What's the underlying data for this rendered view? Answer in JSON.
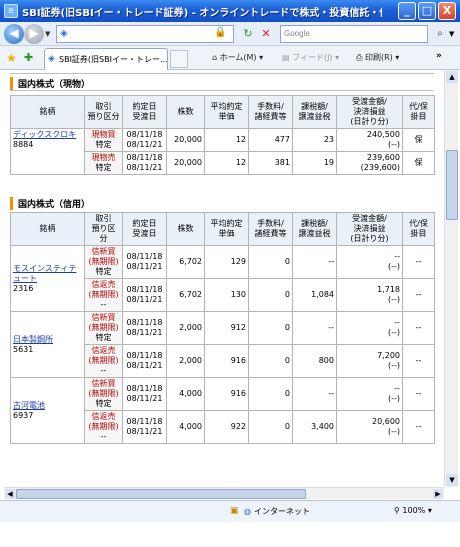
{
  "window": {
    "title": "SBI証券(旧SBIイー・トレード証券) - オンライントレードで株式・投資信託・債券を - W...",
    "min_label": "_",
    "max_label": "□",
    "close_label": "X"
  },
  "address": {
    "search_placeholder": "Google"
  },
  "command": {
    "tab_label": "SBI証券(旧SBIイー・トレー...",
    "home": "ホーム(M)",
    "feed": "フィード(J)",
    "print": "印刷(R)",
    "more": "»"
  },
  "cash": {
    "title": "国内株式（現物）",
    "headers": [
      "銘柄",
      "取引\n預り区分",
      "約定日\n受渡日",
      "株数",
      "平均約定\n単価",
      "手数料/\n諸経費等",
      "課税額/\n譲渡益税",
      "受渡金額/\n決済損益\n(日計り分)",
      "代/保\n掛目"
    ],
    "stock_name": "ディックスクロキ",
    "stock_code": "8884",
    "rows": [
      {
        "type1": "現物買",
        "type2": "特定",
        "d1": "08/11/18",
        "d2": "08/11/21",
        "qty": "20,000",
        "price": "12",
        "fee": "477",
        "tax": "23",
        "amt1": "240,500",
        "amt2": "(--)",
        "flag": "保"
      },
      {
        "type1": "現物売",
        "type2": "特定",
        "d1": "08/11/18",
        "d2": "08/11/21",
        "qty": "20,000",
        "price": "12",
        "fee": "381",
        "tax": "19",
        "amt1": "239,600",
        "amt2": "(239,600)",
        "flag": "保"
      }
    ]
  },
  "margin": {
    "title": "国内株式（信用）",
    "headers": [
      "銘柄",
      "取引\n預り区\n分",
      "約定日\n受渡日",
      "株数",
      "平均約定\n単価",
      "手数料/\n諸経費等",
      "課税額/\n譲渡益税",
      "受渡金額/\n決済損益\n(日計り分)",
      "代/保\n掛目"
    ],
    "groups": [
      {
        "name": "モスインスティテュート",
        "code": "2316",
        "rows": [
          {
            "t1": "信新買",
            "t2": "(無期限)",
            "t3": "特定",
            "d1": "08/11/18",
            "d2": "08/11/21",
            "qty": "6,702",
            "price": "129",
            "fee": "0",
            "tax": "--",
            "amt1": "--",
            "amt2": "(--)",
            "flag": "--"
          },
          {
            "t1": "信返売",
            "t2": "(無期限)",
            "t3": "--",
            "d1": "08/11/18",
            "d2": "08/11/21",
            "qty": "6,702",
            "price": "130",
            "fee": "0",
            "tax": "1,084",
            "amt1": "1,718",
            "amt2": "(--)",
            "flag": "--"
          }
        ]
      },
      {
        "name": "日本製鋼所",
        "code": "5631",
        "rows": [
          {
            "t1": "信新買",
            "t2": "(無期限)",
            "t3": "特定",
            "d1": "08/11/18",
            "d2": "08/11/21",
            "qty": "2,000",
            "price": "912",
            "fee": "0",
            "tax": "--",
            "amt1": "--",
            "amt2": "(--)",
            "flag": "--"
          },
          {
            "t1": "信返売",
            "t2": "(無期限)",
            "t3": "--",
            "d1": "08/11/18",
            "d2": "08/11/21",
            "qty": "2,000",
            "price": "916",
            "fee": "0",
            "tax": "800",
            "amt1": "7,200",
            "amt2": "(--)",
            "flag": "--"
          }
        ]
      },
      {
        "name": "古河電池",
        "code": "6937",
        "rows": [
          {
            "t1": "信新買",
            "t2": "(無期限)",
            "t3": "特定",
            "d1": "08/11/18",
            "d2": "08/11/21",
            "qty": "4,000",
            "price": "916",
            "fee": "0",
            "tax": "--",
            "amt1": "--",
            "amt2": "(--)",
            "flag": "--"
          },
          {
            "t1": "信返売",
            "t2": "(無期限)",
            "t3": "--",
            "d1": "08/11/18",
            "d2": "08/11/21",
            "qty": "4,000",
            "price": "922",
            "fee": "0",
            "tax": "3,400",
            "amt1": "20,600",
            "amt2": "(--)",
            "flag": "--"
          }
        ]
      }
    ]
  },
  "status": {
    "zone": "インターネット",
    "zoom": "100%"
  }
}
